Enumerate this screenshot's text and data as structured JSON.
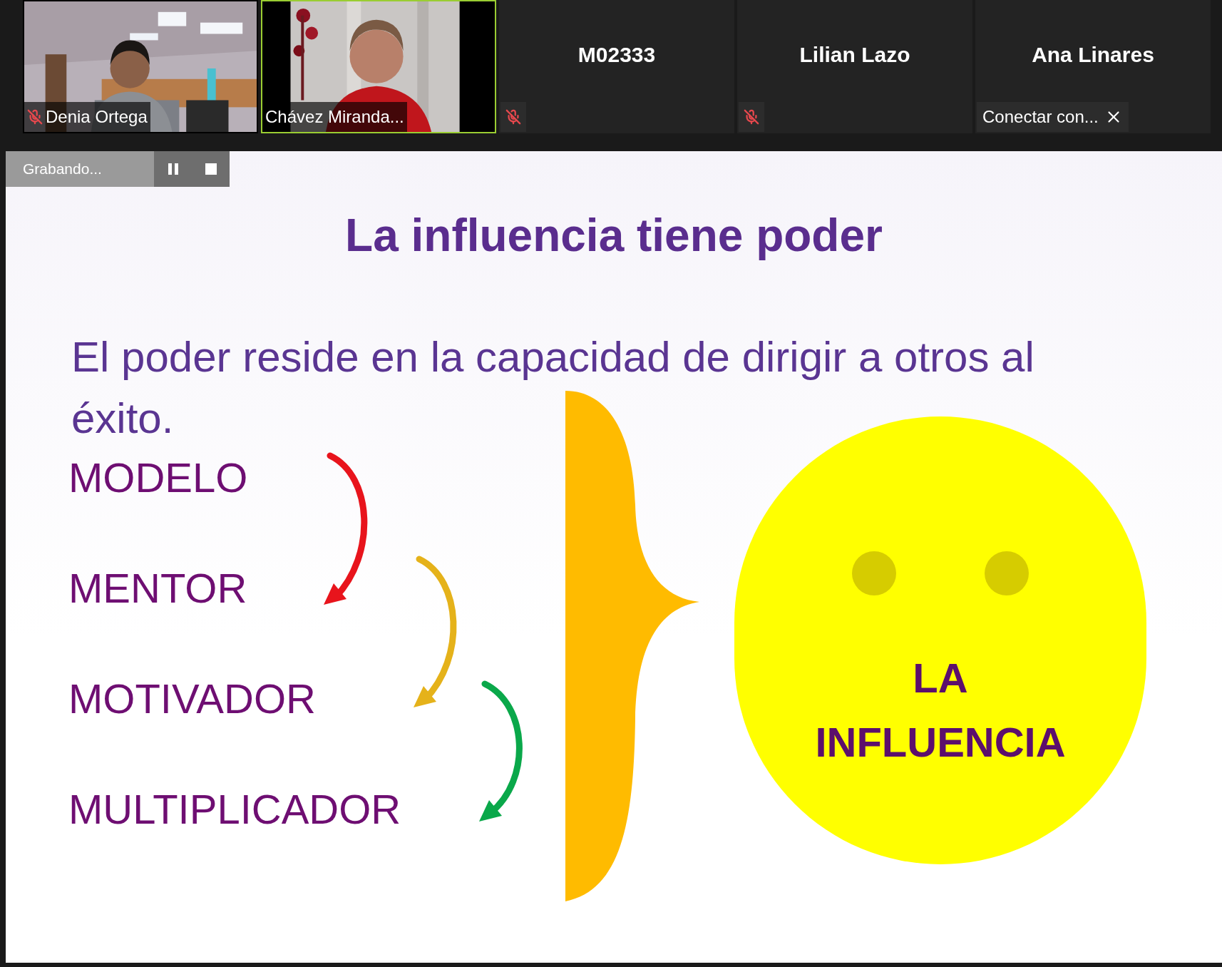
{
  "participants": [
    {
      "kind": "video",
      "name": "Denia Ortega",
      "muted": true,
      "active_speaker": false
    },
    {
      "kind": "video",
      "name": "Chávez Miranda...",
      "muted": false,
      "active_speaker": true
    },
    {
      "kind": "name",
      "name": "M02333",
      "muted": true,
      "active_speaker": false
    },
    {
      "kind": "name",
      "name": "Lilian Lazo",
      "muted": true,
      "active_speaker": false
    },
    {
      "kind": "name",
      "name": "Ana Linares",
      "muted": false,
      "active_speaker": false,
      "notice": "Conectar con..."
    }
  ],
  "recording": {
    "label": "Grabando..."
  },
  "slide": {
    "title": "La influencia tiene poder",
    "text": "El poder reside en la capacidad de dirigir a otros al éxito.",
    "roles": [
      "MODELO",
      "MENTOR",
      "MOTIVADOR",
      "MULTIPLICADOR"
    ],
    "circle_label": "LA INFLUENCIA"
  }
}
